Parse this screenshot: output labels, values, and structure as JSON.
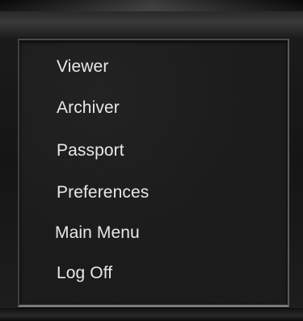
{
  "menu": {
    "items": [
      {
        "label": "Viewer"
      },
      {
        "label": "Archiver"
      },
      {
        "label": "Passport"
      },
      {
        "label": "Preferences"
      },
      {
        "label": "Main Menu"
      },
      {
        "label": "Log Off"
      }
    ]
  },
  "colors": {
    "panel_background": "#1a1a1a",
    "text": "#e8e8e8"
  }
}
